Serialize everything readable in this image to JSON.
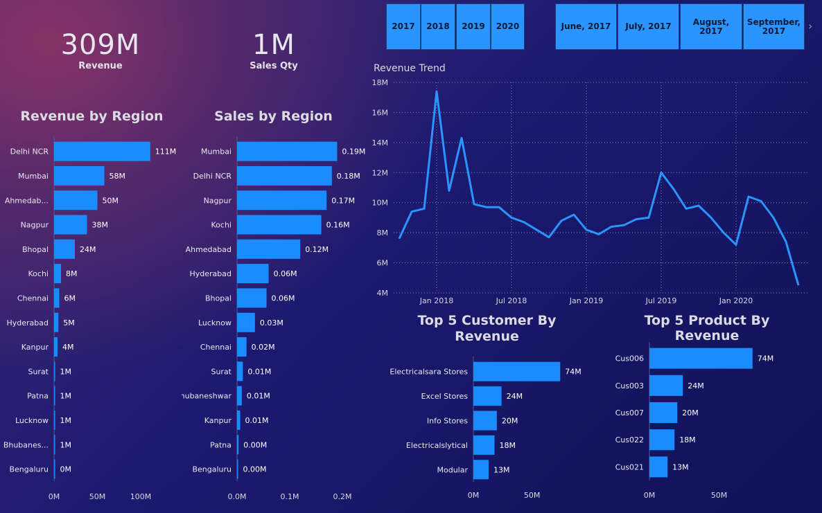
{
  "kpis": {
    "revenue": {
      "value": "309M",
      "label": "Revenue"
    },
    "sales_qty": {
      "value": "1M",
      "label": "Sales Qty"
    }
  },
  "slicers": {
    "years": [
      "2017",
      "2018",
      "2019",
      "2020"
    ],
    "months": [
      "June, 2017",
      "July, 2017",
      "August, 2017",
      "September, 2017"
    ],
    "next_icon": "chevron-right-icon"
  },
  "colors": {
    "bar": "#1a8cff",
    "line": "#2b95ff",
    "slicer": "#2b95ff"
  },
  "chart_data": [
    {
      "id": "revenue_by_region",
      "type": "bar",
      "orientation": "horizontal",
      "title": "Revenue by Region",
      "categories": [
        "Delhi NCR",
        "Mumbai",
        "Ahmedab...",
        "Nagpur",
        "Bhopal",
        "Kochi",
        "Chennai",
        "Hyderabad",
        "Kanpur",
        "Surat",
        "Patna",
        "Lucknow",
        "Bhubanes...",
        "Bengaluru"
      ],
      "values": [
        111,
        58,
        50,
        38,
        24,
        8,
        6,
        5,
        4,
        1,
        1,
        1,
        1,
        0.4
      ],
      "value_labels": [
        "111M",
        "58M",
        "50M",
        "38M",
        "24M",
        "8M",
        "6M",
        "5M",
        "4M",
        "1M",
        "1M",
        "1M",
        "1M",
        "0M"
      ],
      "xlim": [
        0,
        120
      ],
      "x_ticks": [
        0,
        50,
        100
      ],
      "x_tick_labels": [
        "0M",
        "50M",
        "100M"
      ]
    },
    {
      "id": "sales_by_region",
      "type": "bar",
      "orientation": "horizontal",
      "title": "Sales by Region",
      "categories": [
        "Mumbai",
        "Delhi NCR",
        "Nagpur",
        "Kochi",
        "Ahmedabad",
        "Hyderabad",
        "Bhopal",
        "Lucknow",
        "Chennai",
        "Surat",
        "Bhubaneshwar",
        "Kanpur",
        "Patna",
        "Bengaluru"
      ],
      "values": [
        0.19,
        0.18,
        0.17,
        0.16,
        0.12,
        0.06,
        0.056,
        0.034,
        0.018,
        0.011,
        0.009,
        0.006,
        0.003,
        0.001
      ],
      "value_labels": [
        "0.19M",
        "0.18M",
        "0.17M",
        "0.16M",
        "0.12M",
        "0.06M",
        "0.06M",
        "0.03M",
        "0.02M",
        "0.01M",
        "0.01M",
        "0.01M",
        "0.00M",
        "0.00M"
      ],
      "xlim": [
        0,
        0.2
      ],
      "x_ticks": [
        0,
        0.1,
        0.2
      ],
      "x_tick_labels": [
        "0.0M",
        "0.1M",
        "0.2M"
      ]
    },
    {
      "id": "revenue_trend",
      "type": "line",
      "title": "Revenue Trend",
      "x": [
        "2017-10",
        "2017-11",
        "2017-12",
        "2018-01",
        "2018-02",
        "2018-03",
        "2018-04",
        "2018-05",
        "2018-06",
        "2018-07",
        "2018-08",
        "2018-09",
        "2018-10",
        "2018-11",
        "2018-12",
        "2019-01",
        "2019-02",
        "2019-03",
        "2019-04",
        "2019-05",
        "2019-06",
        "2019-07",
        "2019-08",
        "2019-09",
        "2019-10",
        "2019-11",
        "2019-12",
        "2020-01",
        "2020-02",
        "2020-03",
        "2020-04",
        "2020-05",
        "2020-06"
      ],
      "values": [
        7.6,
        9.4,
        9.6,
        17.4,
        10.8,
        14.3,
        9.9,
        9.7,
        9.7,
        9.0,
        8.7,
        8.2,
        7.7,
        8.8,
        9.2,
        8.2,
        7.9,
        8.4,
        8.5,
        8.9,
        9.0,
        12.0,
        10.9,
        9.6,
        9.8,
        9.0,
        8.0,
        7.2,
        10.4,
        10.1,
        9.0,
        7.4,
        4.5
      ],
      "ylim": [
        4,
        18
      ],
      "y_ticks": [
        4,
        6,
        8,
        10,
        12,
        14,
        16,
        18
      ],
      "y_tick_labels": [
        "4M",
        "6M",
        "8M",
        "10M",
        "12M",
        "14M",
        "16M",
        "18M"
      ],
      "x_tick_labels": [
        "Jan 2018",
        "Jul 2018",
        "Jan 2019",
        "Jul 2019",
        "Jan 2020"
      ],
      "x_tick_months": [
        "2018-01",
        "2018-07",
        "2019-01",
        "2019-07",
        "2020-01"
      ],
      "grid": true
    },
    {
      "id": "top5_customer",
      "type": "bar",
      "orientation": "horizontal",
      "title": "Top 5 Customer By Revenue",
      "categories": [
        "Electricalsara Stores",
        "Excel Stores",
        "Info Stores",
        "Electricalslytical",
        "Modular"
      ],
      "values": [
        74,
        24,
        20,
        18,
        13
      ],
      "value_labels": [
        "74M",
        "24M",
        "20M",
        "18M",
        "13M"
      ],
      "xlim": [
        0,
        88
      ],
      "x_ticks": [
        0,
        50
      ],
      "x_tick_labels": [
        "0M",
        "50M"
      ]
    },
    {
      "id": "top5_product",
      "type": "bar",
      "orientation": "horizontal",
      "title": "Top 5 Product By Revenue",
      "categories": [
        "Cus006",
        "Cus003",
        "Cus007",
        "Cus022",
        "Cus021"
      ],
      "values": [
        74,
        24,
        20,
        18,
        13
      ],
      "value_labels": [
        "74M",
        "24M",
        "20M",
        "18M",
        "13M"
      ],
      "xlim": [
        0,
        96
      ],
      "x_ticks": [
        0,
        50
      ],
      "x_tick_labels": [
        "0M",
        "50M"
      ]
    }
  ]
}
